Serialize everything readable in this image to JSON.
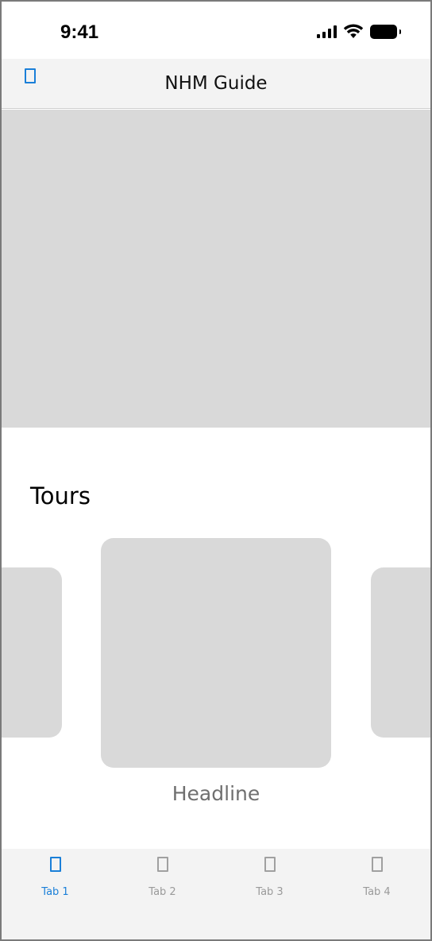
{
  "status_bar": {
    "time": "9:41",
    "icons": [
      "cellular-signal-icon",
      "wifi-icon",
      "battery-icon"
    ]
  },
  "nav_bar": {
    "title": "NHM Guide",
    "left_icon": "nav-placeholder-icon"
  },
  "hero": {
    "type": "image-placeholder"
  },
  "tours": {
    "title": "Tours",
    "featured_headline": "Headline"
  },
  "tab_bar": {
    "tabs": [
      {
        "label": "Tab 1",
        "active": true,
        "icon": "tab-placeholder-icon"
      },
      {
        "label": "Tab 2",
        "active": false,
        "icon": "tab-placeholder-icon"
      },
      {
        "label": "Tab 3",
        "active": false,
        "icon": "tab-placeholder-icon"
      },
      {
        "label": "Tab 4",
        "active": false,
        "icon": "tab-placeholder-icon"
      }
    ]
  },
  "colors": {
    "accent": "#1a7fd8",
    "placeholder": "#d9d9d9",
    "bar_background": "#f3f3f3",
    "inactive": "#9a9a9a"
  }
}
